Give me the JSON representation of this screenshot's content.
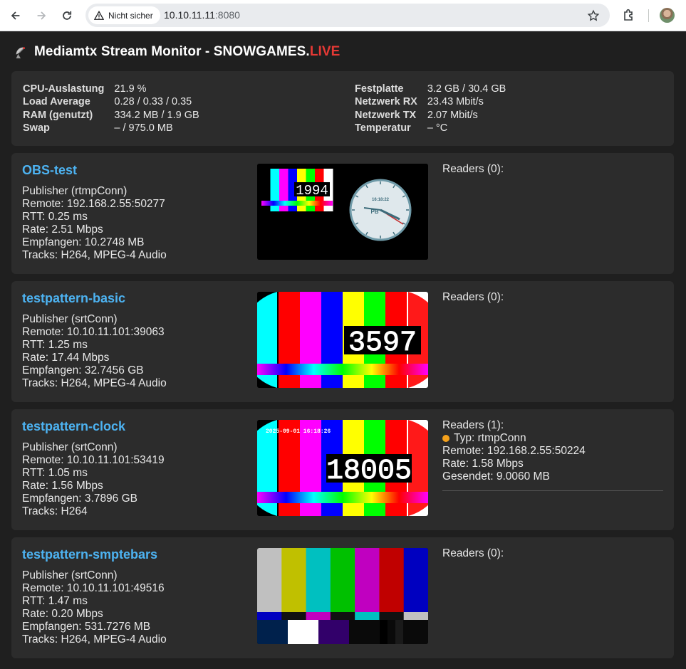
{
  "browser": {
    "security_label": "Nicht sicher",
    "url_host": "10.10.11.11",
    "url_port": ":8080"
  },
  "page": {
    "title_main": "Mediamtx Stream Monitor - SNOWGAMES.",
    "title_live": "LIVE"
  },
  "system": {
    "left": [
      {
        "label": "CPU-Auslastung",
        "value": "21.9 %"
      },
      {
        "label": "Load Average",
        "value": "0.28 / 0.33 / 0.35"
      },
      {
        "label": "RAM (genutzt)",
        "value": "334.2 MB / 1.9 GB"
      },
      {
        "label": "Swap",
        "value": "– / 975.0 MB"
      }
    ],
    "right": [
      {
        "label": "Festplatte",
        "value": "3.2 GB / 30.4 GB"
      },
      {
        "label": "Netzwerk RX",
        "value": "23.43 Mbit/s"
      },
      {
        "label": "Netzwerk TX",
        "value": "2.07 Mbit/s"
      },
      {
        "label": "Temperatur",
        "value": "– °C"
      }
    ]
  },
  "streams": [
    {
      "name": "OBS-test",
      "lines": [
        "Publisher (rtmpConn)",
        "Remote: 192.168.2.55:50277",
        "RTT: 0.25 ms",
        "Rate: 2.51 Mbps",
        "Empfangen: 10.2748 MB",
        "Tracks: H264, MPEG-4 Audio"
      ],
      "readers_title": "Readers (0):",
      "readers": [],
      "thumb": {
        "kind": "obs",
        "counter": "1994",
        "clock_time": "16:18:22",
        "clock_label": "PB"
      }
    },
    {
      "name": "testpattern-basic",
      "lines": [
        "Publisher (srtConn)",
        "Remote: 10.10.11.101:39063",
        "RTT: 1.25 ms",
        "Rate: 17.44 Mbps",
        "Empfangen: 32.7456 GB",
        "Tracks: H264, MPEG-4 Audio"
      ],
      "readers_title": "Readers (0):",
      "readers": [],
      "thumb": {
        "kind": "basic",
        "counter": "3597"
      }
    },
    {
      "name": "testpattern-clock",
      "lines": [
        "Publisher (srtConn)",
        "Remote: 10.10.11.101:53419",
        "RTT: 1.05 ms",
        "Rate: 1.56 Mbps",
        "Empfangen: 3.7896 GB",
        "Tracks: H264"
      ],
      "readers_title": "Readers (1):",
      "readers": [
        {
          "type": "Typ: rtmpConn",
          "remote": "Remote: 192.168.2.55:50224",
          "rate": "Rate: 1.58 Mbps",
          "sent": "Gesendet: 9.0060 MB"
        }
      ],
      "thumb": {
        "kind": "clock",
        "counter": "18005",
        "timestamp": "2025-09-01 16:18:26"
      }
    },
    {
      "name": "testpattern-smptebars",
      "lines": [
        "Publisher (srtConn)",
        "Remote: 10.10.11.101:49516",
        "RTT: 1.47 ms",
        "Rate: 0.20 Mbps",
        "Empfangen: 531.7276 MB",
        "Tracks: H264, MPEG-4 Audio"
      ],
      "readers_title": "Readers (0):",
      "readers": [],
      "thumb": {
        "kind": "smpte"
      }
    }
  ]
}
